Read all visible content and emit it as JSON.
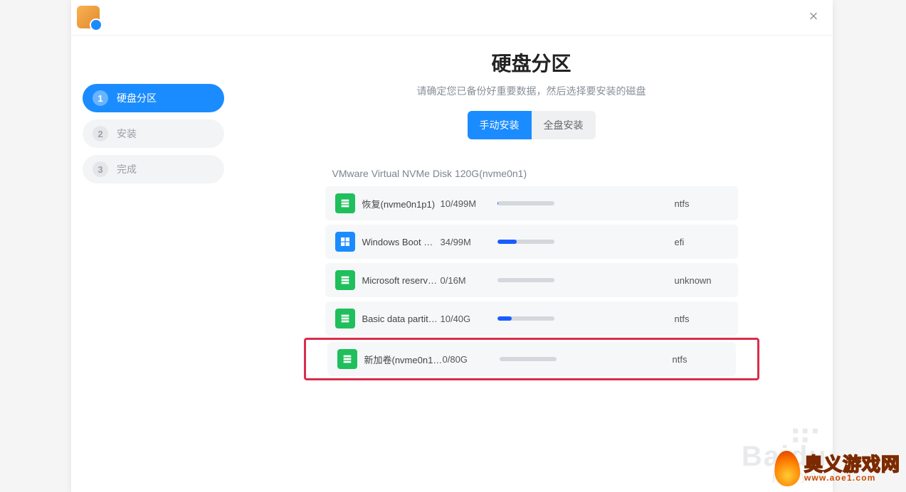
{
  "colors": {
    "accent": "#1a8cff",
    "highlight": "#d82e4a",
    "icon_green": "#1fbf5c"
  },
  "window": {
    "close_label": "×"
  },
  "sidebar": {
    "steps": [
      {
        "num": "1",
        "label": "硬盘分区",
        "active": true
      },
      {
        "num": "2",
        "label": "安装",
        "active": false
      },
      {
        "num": "3",
        "label": "完成",
        "active": false
      }
    ]
  },
  "main": {
    "title": "硬盘分区",
    "subtitle": "请确定您已备份好重要数据，然后选择要安装的磁盘",
    "tabs": [
      {
        "label": "手动安装",
        "active": true
      },
      {
        "label": "全盘安装",
        "active": false
      }
    ]
  },
  "disk": {
    "header": "VMware  Virtual  NVMe  Disk  120G(nvme0n1)",
    "partitions": [
      {
        "icon": "green",
        "name": "恢复(nvme0n1p1)",
        "size": "10/499M",
        "used_pct": 2,
        "fs": "ntfs",
        "highlighted": false
      },
      {
        "icon": "blue",
        "name": "Windows  Boot  …",
        "size": "34/99M",
        "used_pct": 34,
        "fs": "efi",
        "highlighted": false
      },
      {
        "icon": "green",
        "name": "Microsoft  reserv…",
        "size": "0/16M",
        "used_pct": 0,
        "fs": "unknown",
        "highlighted": false
      },
      {
        "icon": "green",
        "name": "Basic  data  partit…",
        "size": "10/40G",
        "used_pct": 25,
        "fs": "ntfs",
        "highlighted": false
      },
      {
        "icon": "green",
        "name": "新加卷(nvme0n1…",
        "size": "0/80G",
        "used_pct": 0,
        "fs": "ntfs",
        "highlighted": true
      }
    ]
  },
  "watermarks": {
    "baidu": {
      "logo": "Baidu",
      "sub": "jingyan"
    },
    "site": {
      "cn": "奥义游戏网",
      "url": "www.aoe1.com"
    }
  }
}
